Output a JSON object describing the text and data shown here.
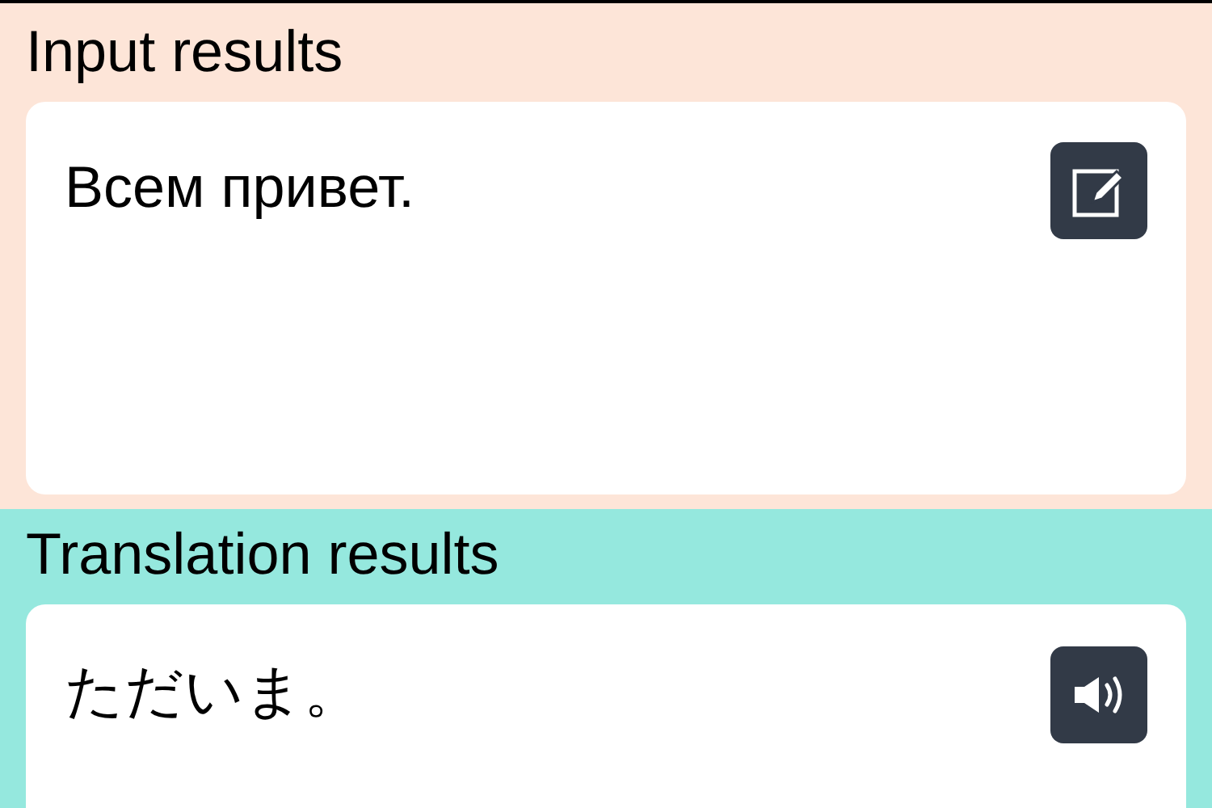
{
  "sections": [
    {
      "kind": "input",
      "title": "Input results",
      "text": "Всем привет."
    },
    {
      "kind": "translation",
      "title": "Translation results",
      "text": "ただいま。"
    }
  ]
}
